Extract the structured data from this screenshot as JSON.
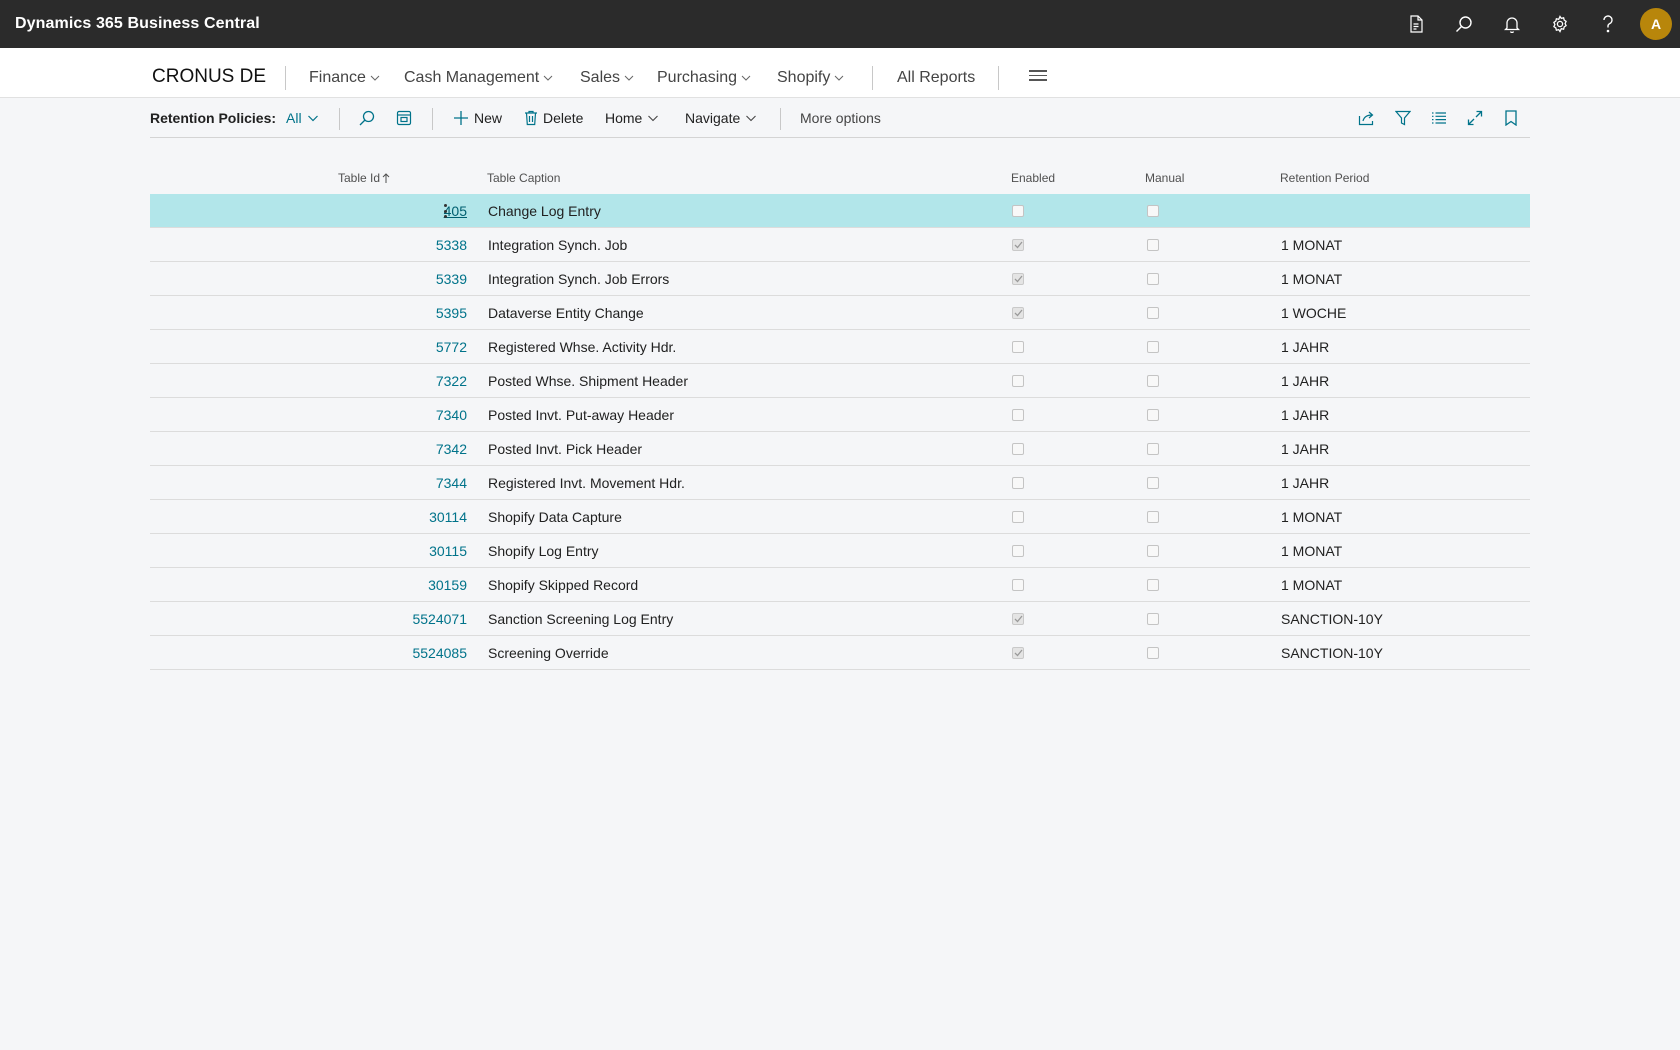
{
  "app": {
    "title": "Dynamics 365 Business Central",
    "avatar_initial": "A"
  },
  "nav": {
    "company": "CRONUS DE",
    "items": [
      "Finance",
      "Cash Management",
      "Sales",
      "Purchasing",
      "Shopify"
    ],
    "all_reports": "All Reports"
  },
  "actions": {
    "page_label": "Retention Policies:",
    "filter_value": "All",
    "new_label": "New",
    "delete_label": "Delete",
    "home_label": "Home",
    "navigate_label": "Navigate",
    "more_label": "More options"
  },
  "columns": {
    "table_id": "Table Id",
    "table_caption": "Table Caption",
    "enabled": "Enabled",
    "manual": "Manual",
    "retention_period": "Retention Period"
  },
  "rows": [
    {
      "id": "405",
      "caption": "Change Log Entry",
      "enabled": false,
      "manual": false,
      "period": ""
    },
    {
      "id": "5338",
      "caption": "Integration Synch. Job",
      "enabled": true,
      "manual": false,
      "period": "1 MONAT"
    },
    {
      "id": "5339",
      "caption": "Integration Synch. Job Errors",
      "enabled": true,
      "manual": false,
      "period": "1 MONAT"
    },
    {
      "id": "5395",
      "caption": "Dataverse Entity Change",
      "enabled": true,
      "manual": false,
      "period": "1 WOCHE"
    },
    {
      "id": "5772",
      "caption": "Registered Whse. Activity Hdr.",
      "enabled": false,
      "manual": false,
      "period": "1 JAHR"
    },
    {
      "id": "7322",
      "caption": "Posted Whse. Shipment Header",
      "enabled": false,
      "manual": false,
      "period": "1 JAHR"
    },
    {
      "id": "7340",
      "caption": "Posted Invt. Put-away Header",
      "enabled": false,
      "manual": false,
      "period": "1 JAHR"
    },
    {
      "id": "7342",
      "caption": "Posted Invt. Pick Header",
      "enabled": false,
      "manual": false,
      "period": "1 JAHR"
    },
    {
      "id": "7344",
      "caption": "Registered Invt. Movement Hdr.",
      "enabled": false,
      "manual": false,
      "period": "1 JAHR"
    },
    {
      "id": "30114",
      "caption": "Shopify Data Capture",
      "enabled": false,
      "manual": false,
      "period": "1 MONAT"
    },
    {
      "id": "30115",
      "caption": "Shopify Log Entry",
      "enabled": false,
      "manual": false,
      "period": "1 MONAT"
    },
    {
      "id": "30159",
      "caption": "Shopify Skipped Record",
      "enabled": false,
      "manual": false,
      "period": "1 MONAT"
    },
    {
      "id": "5524071",
      "caption": "Sanction Screening Log Entry",
      "enabled": true,
      "manual": false,
      "period": "SANCTION-10Y"
    },
    {
      "id": "5524085",
      "caption": "Screening Override",
      "enabled": true,
      "manual": false,
      "period": "SANCTION-10Y"
    }
  ],
  "selected_row": 0,
  "colors": {
    "accent": "#00738a",
    "appbar": "#2b2b2b",
    "selected_row": "#b2e6ea",
    "avatar": "#b8860b"
  }
}
